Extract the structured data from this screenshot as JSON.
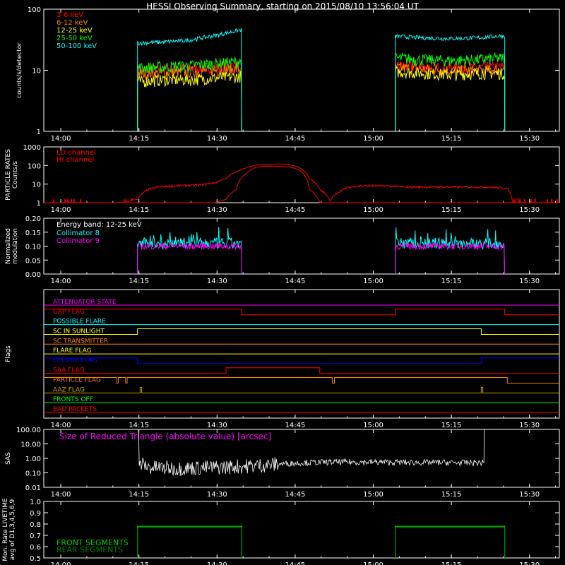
{
  "header": {
    "title": "HESSI Observing Summary, starting on 2015/08/10 13:56:04 UT"
  },
  "time_axis": {
    "ticks": [
      "14:00",
      "14:15",
      "14:30",
      "14:45",
      "15:00",
      "15:15",
      "15:30"
    ],
    "tick_minutes": [
      -1.733,
      13.267,
      28.267,
      43.267,
      58.267,
      73.267,
      88.267
    ],
    "range_minutes": [
      -5,
      94
    ]
  },
  "colors": {
    "background": "#000000",
    "axes": "#ffffff",
    "red": "#ff0000",
    "orange": "#ff7f00",
    "yellow": "#ffff00",
    "green": "#00ff00",
    "cyan": "#00ffff",
    "magenta": "#ff00ff",
    "blue": "#0000ff",
    "olive": "#c8a000",
    "particle_red": "#e01010",
    "front_seg": "#00d000",
    "rear_seg": "#008000"
  },
  "chart_data": [
    {
      "id": "count-rates",
      "type": "line",
      "ylabel": "counts/s/detector",
      "yscale": "log",
      "ylim": [
        1,
        100
      ],
      "yticks": [
        "1",
        "10",
        "100"
      ],
      "ytick_values": [
        1,
        10,
        100
      ],
      "intervals": [
        [
          13.0,
          33.0
        ],
        [
          62.5,
          83.5
        ]
      ],
      "series": [
        {
          "name": "3-6 keV",
          "color": "#ff0000",
          "values_interval1": [
            10,
            10.5,
            11,
            11,
            12
          ],
          "values_interval2": [
            12,
            11.5,
            11,
            11,
            11.5
          ]
        },
        {
          "name": "6-12 keV",
          "color": "#ff7f00",
          "values_interval1": [
            9,
            9,
            9.5,
            10,
            10.5
          ],
          "values_interval2": [
            11,
            10.5,
            10,
            10,
            10.5
          ]
        },
        {
          "name": "12-25 keV",
          "color": "#ffff00",
          "values_interval1": [
            6.5,
            7,
            7,
            7.5,
            8
          ],
          "values_interval2": [
            9.5,
            9,
            8.5,
            9,
            9
          ]
        },
        {
          "name": "25-50 keV",
          "color": "#00ff00",
          "values_interval1": [
            11,
            11.5,
            12,
            13,
            14
          ],
          "values_interval2": [
            16,
            15,
            14.5,
            15,
            16
          ]
        },
        {
          "name": "50-100 keV",
          "color": "#00ffff",
          "values_interval1": [
            28,
            29,
            31,
            37,
            46
          ],
          "values_interval2": [
            36,
            34,
            33,
            34,
            37
          ]
        }
      ]
    },
    {
      "id": "particle-rates",
      "type": "line",
      "ylabel": "PARTICLE RATES Counts/s",
      "yscale": "log",
      "ylim": [
        1,
        1000
      ],
      "yticks": [
        "1",
        "10",
        "100",
        "1000"
      ],
      "ytick_values": [
        1,
        10,
        100,
        1000
      ],
      "series": [
        {
          "name": "LO channel",
          "color": "#ff0000",
          "x": [
            -5,
            10,
            13,
            15,
            17,
            20,
            25,
            28,
            30,
            33,
            36,
            40,
            42,
            44,
            46,
            48,
            50,
            53,
            55,
            60,
            65,
            70,
            75,
            80,
            84,
            85,
            94
          ],
          "y": [
            1,
            1,
            1.5,
            5,
            7,
            8,
            9,
            12,
            20,
            60,
            110,
            120,
            115,
            80,
            20,
            5,
            1.2,
            6,
            8,
            8,
            7,
            7,
            7,
            7,
            6,
            1,
            1
          ]
        },
        {
          "name": "HI channel",
          "color": "#ff0000",
          "x": [
            -5,
            28,
            30,
            32,
            34,
            36,
            38,
            40,
            42,
            44,
            46,
            48,
            94
          ],
          "y": [
            1,
            1,
            1.5,
            5,
            40,
            85,
            90,
            90,
            85,
            60,
            5,
            1,
            1
          ]
        }
      ]
    },
    {
      "id": "modulation",
      "type": "line",
      "ylabel": "Normalized modulation",
      "ylim": [
        0,
        0.2
      ],
      "yticks": [
        "0.00",
        "0.05",
        "0.10",
        "0.15",
        "0.20"
      ],
      "ytick_values": [
        0,
        0.05,
        0.1,
        0.15,
        0.2
      ],
      "annotation": "Energy band: 12-25 keV",
      "intervals": [
        [
          13.0,
          33.0
        ],
        [
          62.5,
          83.5
        ]
      ],
      "series": [
        {
          "name": "Collimator 8",
          "color": "#00ffff",
          "mean": 0.11,
          "spread": 0.02
        },
        {
          "name": "Collimator 9",
          "color": "#ff00ff",
          "mean": 0.1,
          "spread": 0.012
        }
      ]
    },
    {
      "id": "flags",
      "type": "line",
      "ylabel": "Flags",
      "series": [
        {
          "name": "ATTENUATOR STATE",
          "color": "#ff00ff",
          "x": [
            -5,
            94
          ],
          "level": [
            0,
            0
          ]
        },
        {
          "name": "GAP FLAG",
          "color": "#ff0000",
          "x": [
            -5,
            33,
            62.5,
            83.5,
            94
          ],
          "level": [
            1,
            0,
            1,
            0,
            0
          ]
        },
        {
          "name": "POSSIBLE FLARE",
          "color": "#00ffff",
          "x": [
            -5,
            94
          ],
          "level": [
            0,
            0
          ]
        },
        {
          "name": "SC IN SUNLIGHT",
          "color": "#ffff00",
          "x": [
            -5,
            13,
            79,
            94
          ],
          "level": [
            0,
            1,
            0,
            0
          ]
        },
        {
          "name": "SC TRANSMITTER",
          "color": "#ff7f00",
          "x": [
            -5,
            94
          ],
          "level": [
            0,
            0
          ]
        },
        {
          "name": "FLARE FLAG",
          "color": "#ffff00",
          "x": [
            -5,
            94
          ],
          "level": [
            0,
            0
          ]
        },
        {
          "name": "ECLIPSE FLAG",
          "color": "#0000ff",
          "x": [
            -5,
            13,
            79,
            94
          ],
          "level": [
            1,
            0,
            1,
            1
          ]
        },
        {
          "name": "SAA FLAG",
          "color": "#ff0000",
          "x": [
            -5,
            30,
            48,
            94
          ],
          "level": [
            0,
            1,
            0,
            0
          ]
        },
        {
          "name": "PARTICLE FLAG",
          "color": "#ff7f00",
          "x": [
            -5,
            9,
            9.3,
            10.7,
            11,
            30,
            50,
            50.4,
            50.8,
            79.5,
            84,
            94
          ],
          "level": [
            1,
            0,
            1,
            0,
            1,
            1,
            1,
            0,
            1,
            1,
            0,
            0
          ]
        },
        {
          "name": "AAZ FLAG",
          "color": "#c8a000",
          "x": [
            -5,
            13.5,
            13.8,
            79,
            79.3,
            94
          ],
          "level": [
            0,
            1,
            0,
            1,
            0,
            0
          ]
        },
        {
          "name": "FRONTS OFF",
          "color": "#00ff00",
          "x": [
            -5,
            94
          ],
          "level": [
            0,
            0
          ]
        },
        {
          "name": "BAD PACKETS",
          "color": "#ff0000",
          "x": [
            -5,
            94
          ],
          "level": [
            0,
            0
          ]
        }
      ]
    },
    {
      "id": "sas",
      "type": "line",
      "ylabel": "SAS",
      "yscale": "log",
      "ylim": [
        0.01,
        100
      ],
      "yticks": [
        "0.01",
        "0.10",
        "1.00",
        "10.00",
        "100.00"
      ],
      "ytick_values": [
        0.01,
        0.1,
        1,
        10,
        100
      ],
      "annotation": "Size of Reduced Triangle (absolute value) [arcsec]",
      "series": [
        {
          "name": "Size of Reduced Triangle",
          "color": "#ffffff",
          "x": [
            14,
            15,
            20,
            25,
            30,
            35,
            40,
            45,
            50,
            55,
            60,
            65,
            70,
            75,
            79
          ],
          "y": [
            0.4,
            0.25,
            0.2,
            0.22,
            0.25,
            0.3,
            0.4,
            0.5,
            0.55,
            0.55,
            0.55,
            0.52,
            0.52,
            0.5,
            0.5
          ]
        }
      ]
    },
    {
      "id": "livetime",
      "type": "line",
      "ylabel": "Mon. Rate LIVETIME avg of D1,3,4,5,6,9",
      "ylim": [
        0.5,
        1.0
      ],
      "yticks": [
        "0.5",
        "0.6",
        "0.7",
        "0.8",
        "0.9",
        "1.0"
      ],
      "ytick_values": [
        0.5,
        0.6,
        0.7,
        0.8,
        0.9,
        1.0
      ],
      "intervals": [
        [
          13.0,
          33.0
        ],
        [
          62.5,
          83.5
        ]
      ],
      "series": [
        {
          "name": "FRONT SEGMENTS",
          "color": "#00d000",
          "value": 0.78
        },
        {
          "name": "REAR SEGMENTS",
          "color": "#008000",
          "value": 0.77
        }
      ]
    }
  ]
}
